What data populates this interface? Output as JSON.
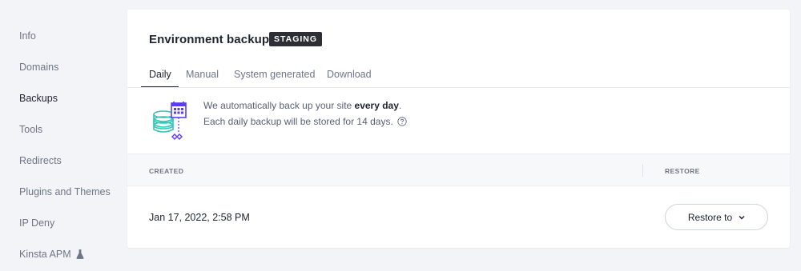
{
  "sidebar": {
    "items": [
      {
        "label": "Info"
      },
      {
        "label": "Domains"
      },
      {
        "label": "Backups",
        "active": true
      },
      {
        "label": "Tools"
      },
      {
        "label": "Redirects"
      },
      {
        "label": "Plugins and Themes"
      },
      {
        "label": "IP Deny"
      },
      {
        "label": "Kinsta APM",
        "icon": "flask-icon"
      }
    ]
  },
  "card": {
    "title": "Environment backups",
    "badge": "STAGING",
    "tabs": [
      {
        "label": "Daily",
        "active": true
      },
      {
        "label": "Manual"
      },
      {
        "label": "System generated"
      },
      {
        "label": "Download"
      }
    ],
    "info": {
      "illustration": "database-calendar-icon",
      "line1_prefix": "We automatically back up your site ",
      "line1_bold": "every day",
      "line1_suffix": ".",
      "line2": "Each daily backup will be stored for 14 days.",
      "help_icon": "help-circle-icon"
    },
    "table": {
      "columns": [
        "CREATED",
        "RESTORE"
      ],
      "rows": [
        {
          "created": "Jan 17, 2022, 2:58 PM",
          "restore_label": "Restore to"
        }
      ]
    }
  },
  "colors": {
    "background": "#f3f4f7",
    "illustration_purple": "#5b3cf5",
    "illustration_teal": "#33c7b8",
    "badge": "#2c2f36"
  }
}
